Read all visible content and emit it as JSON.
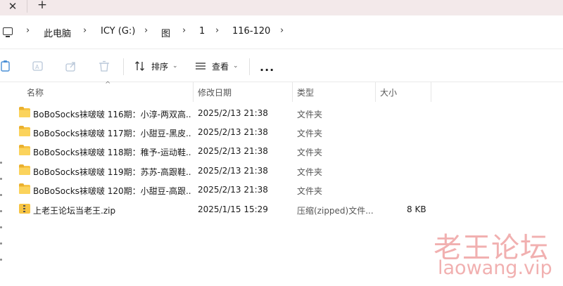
{
  "tabbar": {
    "close_glyph": "✕",
    "new_glyph": "+"
  },
  "breadcrumb": {
    "items": [
      "此电脑",
      "ICY (G:)",
      "图",
      "1",
      "116-120"
    ]
  },
  "toolbar": {
    "sort_label": "排序",
    "view_label": "查看",
    "more_label": "..."
  },
  "columns": {
    "name": "名称",
    "date": "修改日期",
    "type": "类型",
    "size": "大小"
  },
  "files": [
    {
      "name": "BoBoSocks袜啵啵 116期：小淳-两双高...",
      "date": "2025/2/13 21:38",
      "type": "文件夹",
      "size": "",
      "icon": "folder-icon"
    },
    {
      "name": "BoBoSocks袜啵啵 117期：小甜豆-黑皮...",
      "date": "2025/2/13 21:38",
      "type": "文件夹",
      "size": "",
      "icon": "folder-icon"
    },
    {
      "name": "BoBoSocks袜啵啵 118期：稚予-运动鞋...",
      "date": "2025/2/13 21:38",
      "type": "文件夹",
      "size": "",
      "icon": "folder-icon"
    },
    {
      "name": "BoBoSocks袜啵啵 119期：苏苏-高跟鞋...",
      "date": "2025/2/13 21:38",
      "type": "文件夹",
      "size": "",
      "icon": "folder-icon"
    },
    {
      "name": "BoBoSocks袜啵啵 120期：小甜豆-高跟...",
      "date": "2025/2/13 21:38",
      "type": "文件夹",
      "size": "",
      "icon": "folder-icon"
    },
    {
      "name": "上老王论坛当老王.zip",
      "date": "2025/1/15 15:29",
      "type": "压缩(zipped)文件...",
      "size": "8 KB",
      "icon": "zip-icon"
    }
  ],
  "watermark": {
    "cn": "老王论坛",
    "en": "laowang.vip",
    "color": "#f0a8a8"
  },
  "colors": {
    "tabbar_bg": "#f3e9ea",
    "folder": "#f7c443"
  }
}
